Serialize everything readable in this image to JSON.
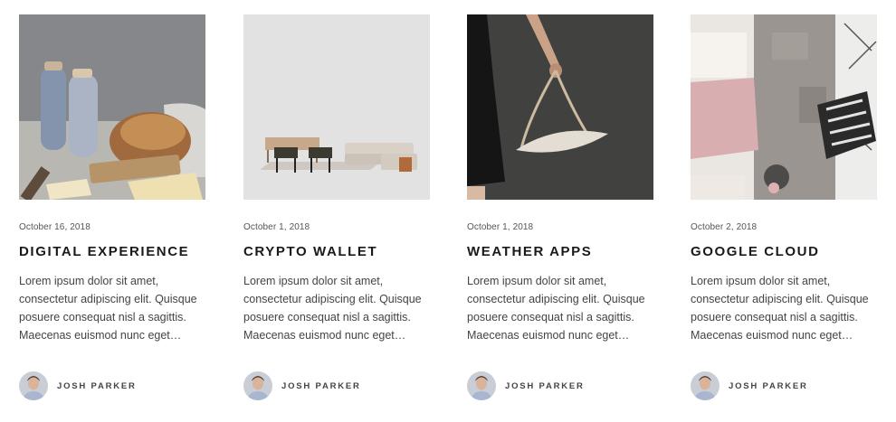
{
  "posts": [
    {
      "date": "October 16, 2018",
      "title": "DIGITAL EXPERIENCE",
      "excerpt": "Lorem ipsum dolor sit amet, consectetur adipiscing elit. Quisque posuere consequat nisl a sagittis. Maecenas euismod nunc eget…",
      "author": "JOSH PARKER",
      "image_icon": "bread-and-bottles-photo"
    },
    {
      "date": "October 1, 2018",
      "title": "CRYPTO WALLET",
      "excerpt": "Lorem ipsum dolor sit amet, consectetur adipiscing elit. Quisque posuere consequat nisl a sagittis. Maecenas euismod nunc eget…",
      "author": "JOSH PARKER",
      "image_icon": "furniture-set-photo"
    },
    {
      "date": "October 1, 2018",
      "title": "WEATHER APPS",
      "excerpt": "Lorem ipsum dolor sit amet, consectetur adipiscing elit. Quisque posuere consequat nisl a sagittis. Maecenas euismod nunc eget…",
      "author": "JOSH PARKER",
      "image_icon": "hanging-swing-photo"
    },
    {
      "date": "October 2, 2018",
      "title": "GOOGLE CLOUD",
      "excerpt": "Lorem ipsum dolor sit amet, consectetur adipiscing elit. Quisque posuere consequat nisl a sagittis. Maecenas euismod nunc eget…",
      "author": "JOSH PARKER",
      "image_icon": "bedroom-rug-photo"
    }
  ],
  "colors": {
    "title": "#1a1a1a",
    "text": "#444444",
    "date": "#555555"
  }
}
